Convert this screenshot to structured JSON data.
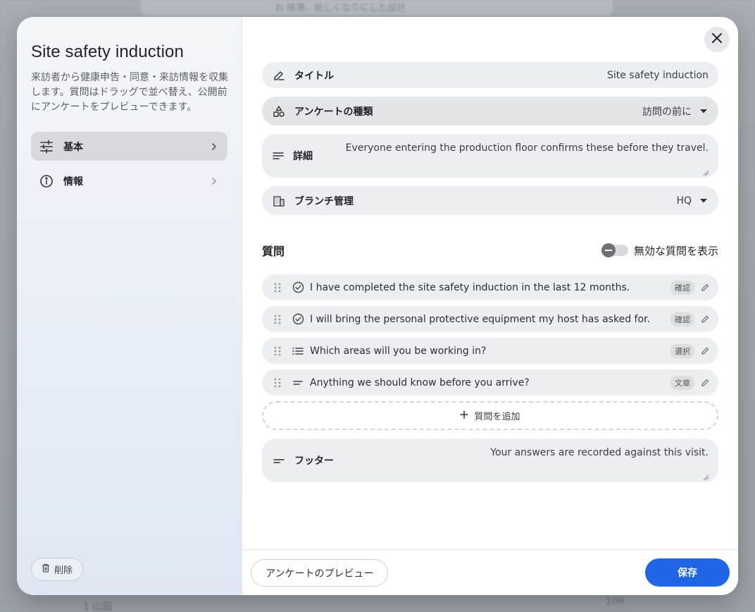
{
  "background": {
    "top_bar_text": "お 帳簿、新しくなりにした設計",
    "bottom_left_text": "1 山田",
    "bottom_right_text": "10H"
  },
  "sidebar": {
    "title": "Site safety induction",
    "description": "来訪者から健康申告・同意・来訪情報を収集します。質問はドラッグで並べ替え、公開前にアンケートをプレビューできます。",
    "items": [
      {
        "label": "基本",
        "icon": "sliders-icon",
        "active": true
      },
      {
        "label": "情報",
        "icon": "info-icon",
        "active": false
      }
    ],
    "delete_label": "削除"
  },
  "form": {
    "title_label": "タイトル",
    "title_value": "Site safety induction",
    "type_label": "アンケートの種類",
    "type_value": "訪問の前に",
    "details_label": "詳細",
    "details_value": "Everyone entering the production floor confirms these before they travel.",
    "branch_label": "ブランチ管理",
    "branch_value": "HQ"
  },
  "questions": {
    "heading": "質問",
    "toggle_label": "無効な質問を表示",
    "items": [
      {
        "text": "I have completed the site safety induction in the last 12 months.",
        "badge": "確認",
        "icon": "check-circle-icon"
      },
      {
        "text": "I will bring the personal protective equipment my host has asked for.",
        "badge": "確認",
        "icon": "check-circle-icon"
      },
      {
        "text": "Which areas will you be working in?",
        "badge": "選択",
        "icon": "list-icon"
      },
      {
        "text": "Anything we should know before you arrive?",
        "badge": "文章",
        "icon": "short-text-icon"
      }
    ],
    "add_label": "質問を追加"
  },
  "footer_field": {
    "label": "フッター",
    "value": "Your answers are recorded against this visit."
  },
  "actions": {
    "preview_label": "アンケートのプレビュー",
    "save_label": "保存"
  },
  "colors": {
    "primary": "#1f66e5",
    "field_bg": "#eceef1"
  }
}
